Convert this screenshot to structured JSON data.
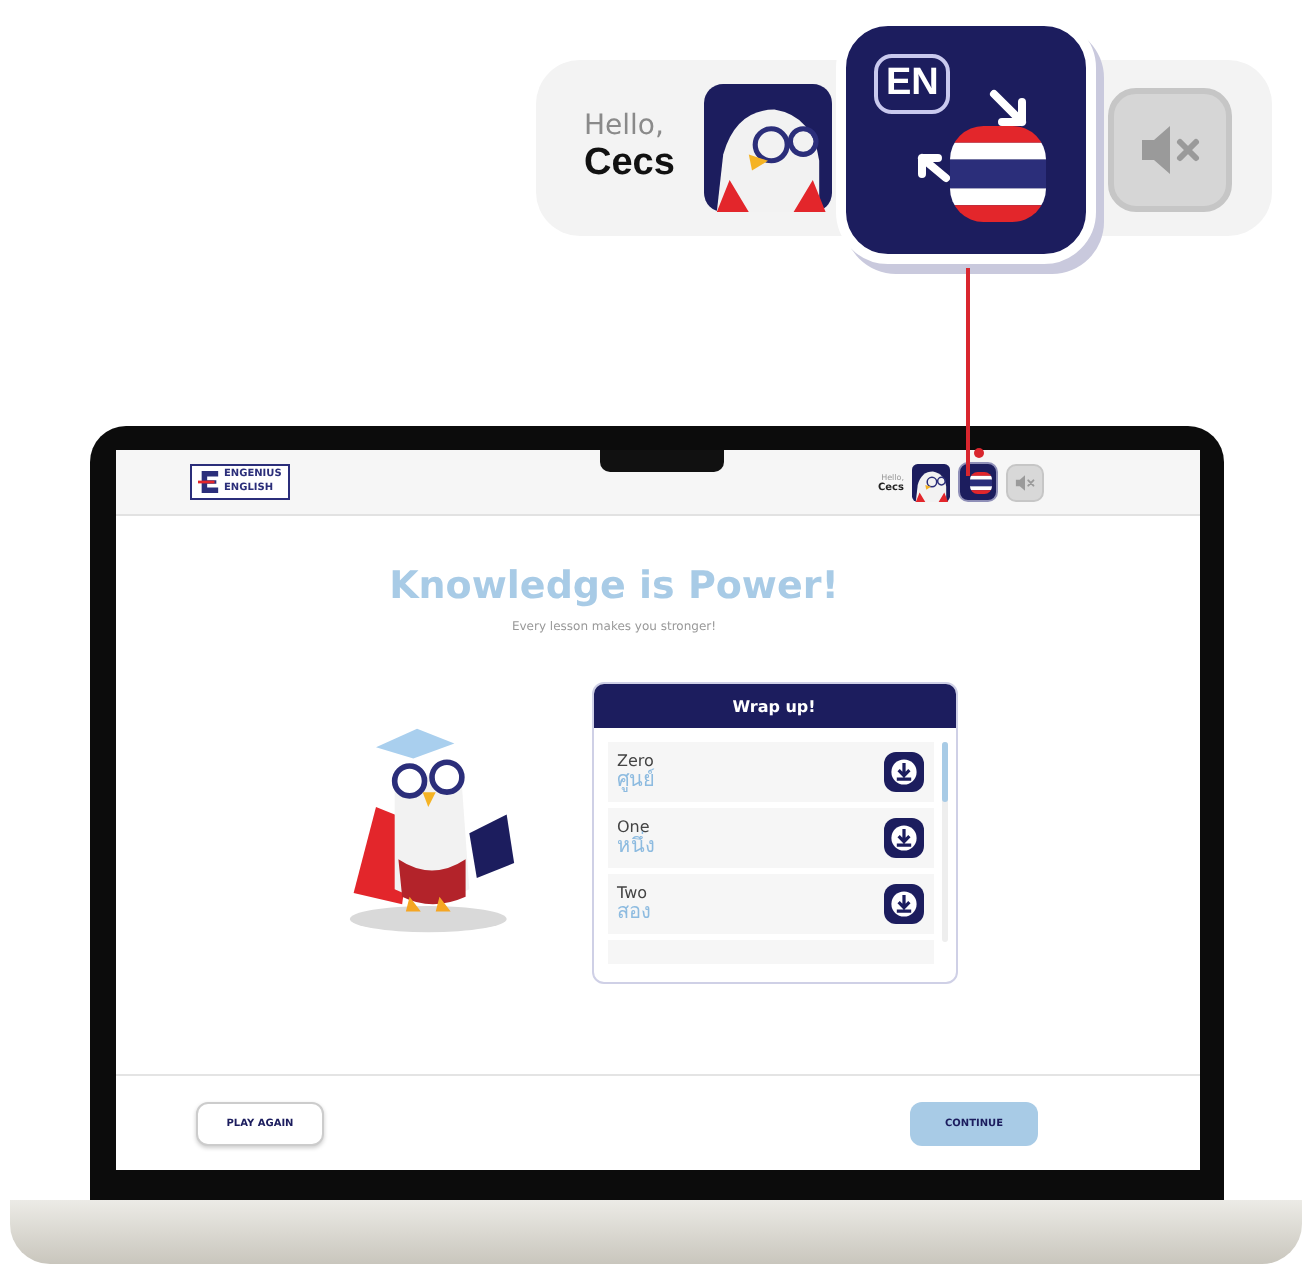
{
  "callout": {
    "greeting": "Hello,",
    "user_name": "Cecs",
    "language_from": "EN",
    "sound_muted": true
  },
  "app": {
    "logo": [
      "ENGENIUS",
      "ENGLISH"
    ],
    "greeting": "Hello,",
    "user_name": "Cecs",
    "sound_muted": true,
    "title": "Knowledge is Power!",
    "subtitle": "Every lesson makes you stronger!",
    "wrap_up": {
      "title": "Wrap up!",
      "words": [
        {
          "english": "Zero",
          "thai": "ศูนย์"
        },
        {
          "english": "One",
          "thai": "หนึ่ง"
        },
        {
          "english": "Two",
          "thai": "สอง"
        }
      ]
    },
    "buttons": [
      {
        "label": "PLAY AGAIN",
        "kind": "secondary"
      },
      {
        "label": "CONTINUE",
        "kind": "primary"
      }
    ]
  }
}
